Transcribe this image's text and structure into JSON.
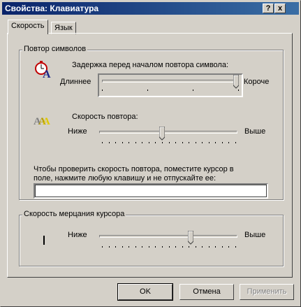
{
  "window": {
    "title": "Свойства: Клавиатура",
    "help_glyph": "?",
    "close_glyph": "x"
  },
  "tabs": [
    {
      "label": "Скорость",
      "active": true
    },
    {
      "label": "Язык",
      "active": false
    }
  ],
  "repeat_group": {
    "label": "Повтор символов",
    "delay": {
      "label": "Задержка перед началом повтора символа:",
      "left": "Длиннее",
      "right": "Короче",
      "level": 1.0,
      "ticks": 4
    },
    "rate": {
      "label": "Скорость повтора:",
      "left": "Ниже",
      "right": "Выше",
      "level": 0.45,
      "ticks": 21
    },
    "test": {
      "label_line1": "Чтобы проверить скорость повтора, поместите курсор в",
      "label_line2": "поле, нажмите любую клавишу и не отпускайте ее:",
      "value": ""
    }
  },
  "cursor_group": {
    "label": "Скорость мерцания курсора",
    "blink": {
      "left": "Ниже",
      "right": "Выше",
      "level": 0.67,
      "ticks": 21
    }
  },
  "buttons": {
    "ok": "OK",
    "cancel": "Отмена",
    "apply": "Применить"
  },
  "icons": {
    "delay": "stopwatch-letter-a-icon",
    "rate": "repeated-letters-icon",
    "cursor": "text-cursor-icon"
  }
}
